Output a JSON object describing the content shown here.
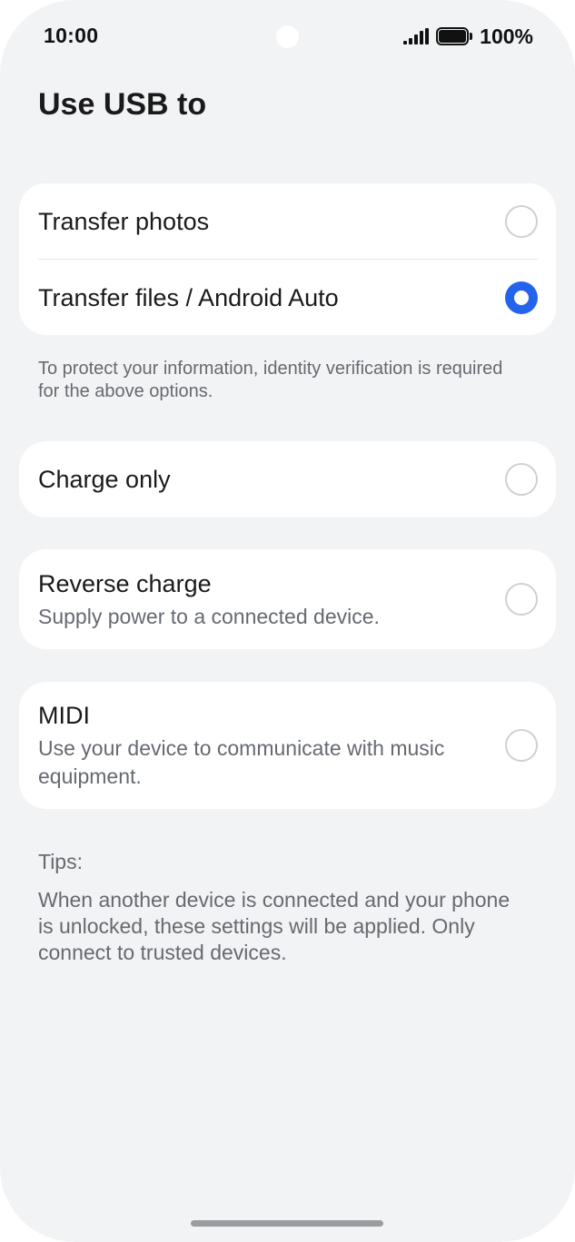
{
  "status_bar": {
    "time": "10:00",
    "battery": "100%",
    "icons": [
      "camera-dot",
      "signal-icon",
      "battery-icon"
    ]
  },
  "page": {
    "title": "Use USB to"
  },
  "group1": {
    "options": [
      {
        "label": "Transfer photos",
        "selected": false
      },
      {
        "label": "Transfer files / Android Auto",
        "selected": true
      }
    ],
    "note": "To protect your information, identity verification is required for the above options."
  },
  "charge_only": {
    "label": "Charge only",
    "selected": false
  },
  "reverse_charge": {
    "label": "Reverse charge",
    "description": "Supply power to a connected device.",
    "selected": false
  },
  "midi": {
    "label": "MIDI",
    "description": "Use your device to communicate with music equipment.",
    "selected": false
  },
  "tips": {
    "label": "Tips:",
    "text": "When another device is connected and your phone is unlocked, these settings will be applied. Only connect to trusted devices."
  },
  "colors": {
    "accent": "#2463eb",
    "background": "#f2f3f5",
    "card": "#ffffff"
  }
}
